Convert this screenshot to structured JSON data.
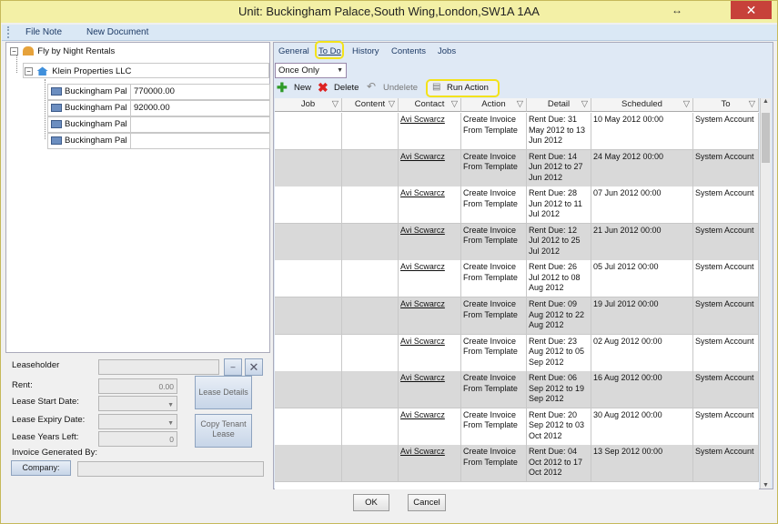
{
  "window": {
    "title": "Unit: Buckingham Palace,South Wing,London,SW1A 1AA",
    "resize_glyph": "↔",
    "close_glyph": "✕"
  },
  "menu": {
    "items": [
      "File Note",
      "New Document"
    ]
  },
  "tree": {
    "root": "Fly by Night Rentals",
    "child": "Klein Properties LLC",
    "units": [
      {
        "name": "Buckingham Pal",
        "value": "770000.00"
      },
      {
        "name": "Buckingham Pal",
        "value": "92000.00"
      },
      {
        "name": "Buckingham Pal",
        "value": ""
      },
      {
        "name": "Buckingham Pal",
        "value": ""
      }
    ]
  },
  "form": {
    "leaseholder_label": "Leaseholder",
    "rent_label": "Rent:",
    "rent_value": "0.00",
    "start_label": "Lease Start Date:",
    "expiry_label": "Lease Expiry Date:",
    "years_label": "Lease Years Left:",
    "years_value": "0",
    "invoice_label": "Invoice Generated By:",
    "company_label": "Company:",
    "lease_details_label": "Lease Details",
    "copy_tenant_label": "Copy Tenant Lease",
    "dash_label": "–"
  },
  "tabs": [
    "General",
    "To Do",
    "History",
    "Contents",
    "Jobs"
  ],
  "frequency": {
    "value": "Once Only"
  },
  "toolbar": {
    "new": "New",
    "delete": "Delete",
    "undelete": "Undelete",
    "run": "Run Action"
  },
  "columns": [
    "Job",
    "Content",
    "Contact",
    "Action",
    "Detail",
    "Scheduled",
    "To"
  ],
  "rows": [
    {
      "contact": "Avi Scwarcz",
      "action": "Create Invoice From Template",
      "detail": "Rent Due: 31 May 2012 to 13 Jun 2012",
      "scheduled": "10 May 2012 00:00",
      "to": "System Account"
    },
    {
      "contact": "Avi Scwarcz",
      "action": "Create Invoice From Template",
      "detail": "Rent Due: 14 Jun 2012 to 27 Jun 2012",
      "scheduled": "24 May 2012 00:00",
      "to": "System Account"
    },
    {
      "contact": "Avi Scwarcz",
      "action": "Create Invoice From Template",
      "detail": "Rent Due: 28 Jun 2012 to 11 Jul 2012",
      "scheduled": "07 Jun 2012 00:00",
      "to": "System Account"
    },
    {
      "contact": "Avi Scwarcz",
      "action": "Create Invoice From Template",
      "detail": "Rent Due: 12 Jul 2012 to 25 Jul 2012",
      "scheduled": "21 Jun 2012 00:00",
      "to": "System Account"
    },
    {
      "contact": "Avi Scwarcz",
      "action": "Create Invoice From Template",
      "detail": "Rent Due: 26 Jul 2012 to 08 Aug 2012",
      "scheduled": "05 Jul 2012 00:00",
      "to": "System Account"
    },
    {
      "contact": "Avi Scwarcz",
      "action": "Create Invoice From Template",
      "detail": "Rent Due: 09 Aug 2012 to 22 Aug 2012",
      "scheduled": "19 Jul 2012 00:00",
      "to": "System Account"
    },
    {
      "contact": "Avi Scwarcz",
      "action": "Create Invoice From Template",
      "detail": "Rent Due: 23 Aug 2012 to 05 Sep 2012",
      "scheduled": "02 Aug 2012 00:00",
      "to": "System Account"
    },
    {
      "contact": "Avi Scwarcz",
      "action": "Create Invoice From Template",
      "detail": "Rent Due: 06 Sep 2012 to 19 Sep 2012",
      "scheduled": "16 Aug 2012 00:00",
      "to": "System Account"
    },
    {
      "contact": "Avi Scwarcz",
      "action": "Create Invoice From Template",
      "detail": "Rent Due: 20 Sep 2012 to 03 Oct 2012",
      "scheduled": "30 Aug 2012 00:00",
      "to": "System Account"
    },
    {
      "contact": "Avi Scwarcz",
      "action": "Create Invoice From Template",
      "detail": "Rent Due: 04 Oct 2012 to 17 Oct 2012",
      "scheduled": "13 Sep 2012 00:00",
      "to": "System Account"
    }
  ],
  "buttons": {
    "ok": "OK",
    "cancel": "Cancel"
  }
}
